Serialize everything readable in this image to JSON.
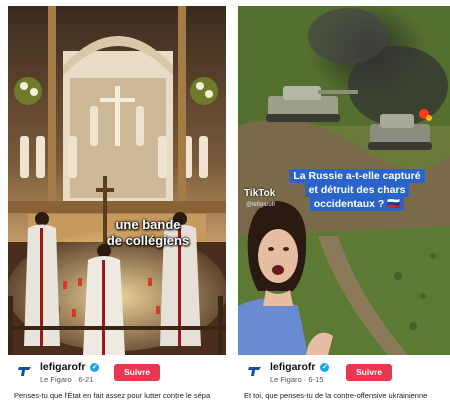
{
  "posts": [
    {
      "caption_lines": [
        "une bande",
        "de collégiens"
      ],
      "account": "lefigarofr",
      "source": "Le Figaro",
      "date": "6-21",
      "follow_label": "Suivre",
      "description": "Penses-tu que l'État en fait assez pour lutter contre le sépa"
    },
    {
      "caption_lines": [
        "La Russie a-t-elle capturé",
        "et détruit des chars",
        "occidentaux ? 🇷🇺"
      ],
      "tiktok_mark": "TikTok",
      "tiktok_user": "@lefigarofr",
      "account": "lefigarofr",
      "source": "Le Figaro",
      "date": "6-15",
      "follow_label": "Suivre",
      "description": "Et toi, que penses-tu de la contre-offensive ukrainienne"
    }
  ],
  "separator": "·",
  "verified_icon": "✓",
  "colors": {
    "follow_button": "#e8384f",
    "caption_highlight": "#2b64c8",
    "verified_badge": "#1da1f2"
  }
}
